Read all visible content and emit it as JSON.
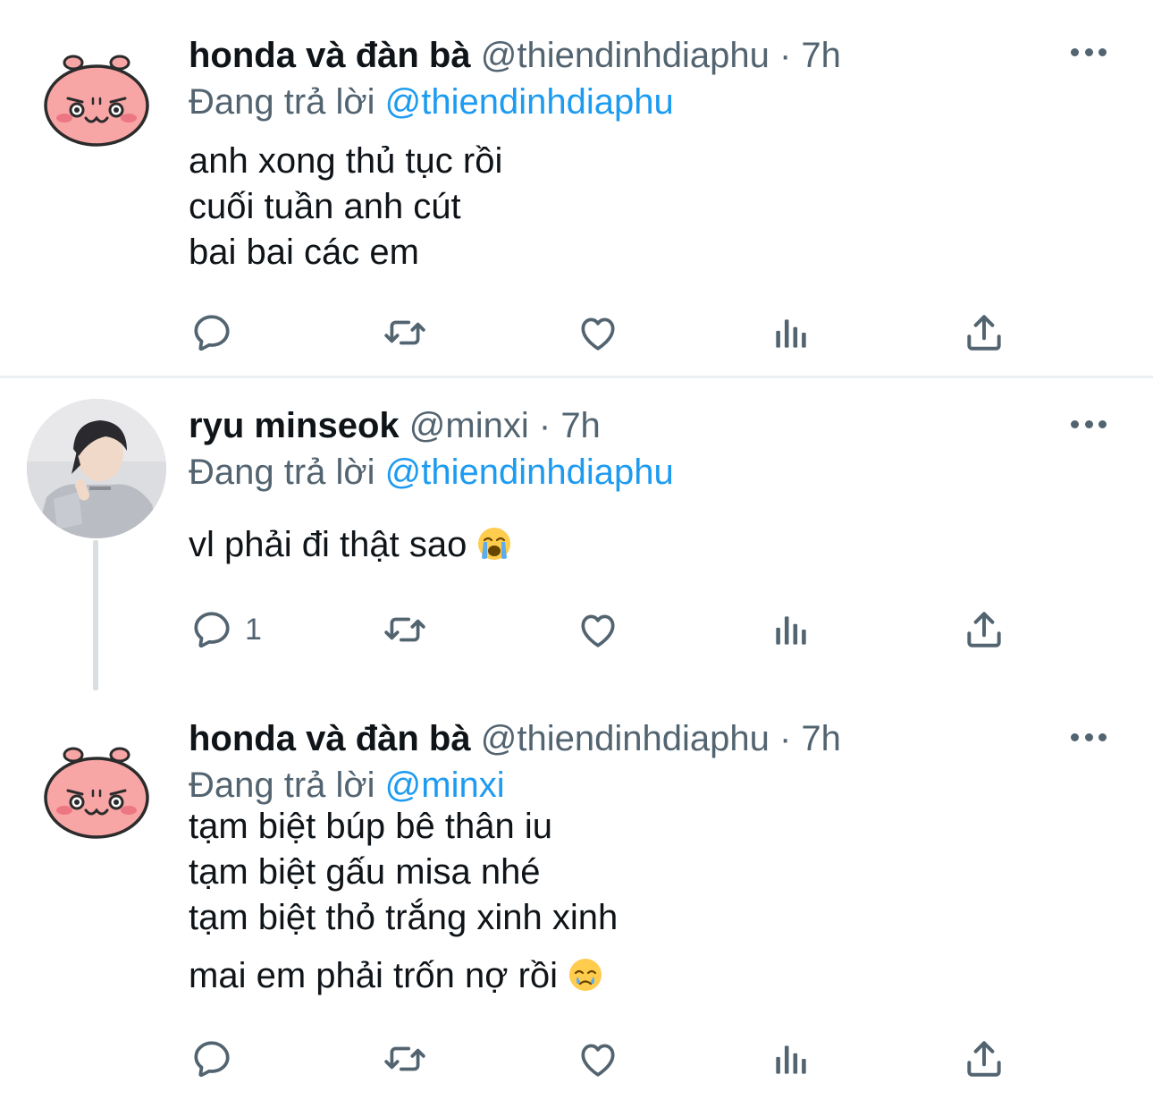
{
  "tweets": [
    {
      "name": "honda và đàn bà",
      "handle": "@thiendinhdiaphu",
      "separator": "·",
      "time": "7h",
      "replying_prefix": "Đang trả lời",
      "replying_to": "@thiendinhdiaphu",
      "lines": [
        "anh xong thủ tục rồi",
        "cuối tuần anh cút",
        "bai bai các em"
      ],
      "reply_count": ""
    },
    {
      "name": "ryu minseok",
      "handle": "@minxi",
      "separator": "·",
      "time": "7h",
      "replying_prefix": "Đang trả lời",
      "replying_to": "@thiendinhdiaphu",
      "lines": [
        "vl phải đi thật sao"
      ],
      "reply_count": "1"
    },
    {
      "name": "honda và đàn bà",
      "handle": "@thiendinhdiaphu",
      "separator": "·",
      "time": "7h",
      "replying_prefix": "Đang trả lời",
      "replying_to": "@minxi",
      "lines": [
        "tạm biệt búp bê thân iu",
        "tạm biệt gấu misa nhé",
        "tạm biệt thỏ trắng xinh xinh",
        "mai em phải trốn nợ rồi"
      ],
      "reply_count": ""
    }
  ],
  "icons": {
    "reply": "reply-icon",
    "retweet": "retweet-icon",
    "like": "heart-icon",
    "views": "views-icon",
    "share": "share-icon",
    "more": "more-icon",
    "emoji_crying": "loudly-crying-face-emoji",
    "emoji_tear": "face-holding-back-tears-emoji"
  },
  "colors": {
    "text": "#0f1419",
    "secondary": "#536471",
    "link": "#1d9bf0",
    "avatar_pig": "#f8a5a5"
  }
}
